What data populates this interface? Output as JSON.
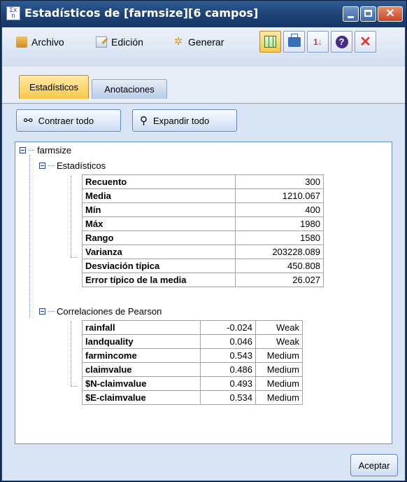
{
  "window": {
    "title": "Estadísticos de [farmsize][6 campos]",
    "icon_text": "ΣX n"
  },
  "menu": {
    "file": "Archivo",
    "edit": "Edición",
    "generate": "Generar"
  },
  "toolbar_icons": [
    "table-icon",
    "print-icon",
    "sort-icon",
    "help-icon",
    "close-x-icon"
  ],
  "tabs": {
    "statistics": "Estadísticos",
    "annotations": "Anotaciones"
  },
  "actions": {
    "collapse_all": "Contraer todo",
    "expand_all": "Expandir todo"
  },
  "tree": {
    "root": "farmsize",
    "statistics_node": "Estadísticos",
    "correlations_node": "Correlaciones de Pearson",
    "statistics": [
      {
        "label": "Recuento",
        "value": "300"
      },
      {
        "label": "Media",
        "value": "1210.067"
      },
      {
        "label": "Mín",
        "value": "400"
      },
      {
        "label": "Máx",
        "value": "1980"
      },
      {
        "label": "Rango",
        "value": "1580"
      },
      {
        "label": "Varianza",
        "value": "203228.089"
      },
      {
        "label": "Desviación típica",
        "value": "450.808"
      },
      {
        "label": "Error típico de la media",
        "value": "26.027"
      }
    ],
    "correlations": [
      {
        "field": "rainfall",
        "value": "-0.024",
        "strength": "Weak"
      },
      {
        "field": "landquality",
        "value": "0.046",
        "strength": "Weak"
      },
      {
        "field": "farmincome",
        "value": "0.543",
        "strength": "Medium"
      },
      {
        "field": "claimvalue",
        "value": "0.486",
        "strength": "Medium"
      },
      {
        "field": "$N-claimvalue",
        "value": "0.493",
        "strength": "Medium"
      },
      {
        "field": "$E-claimvalue",
        "value": "0.534",
        "strength": "Medium"
      }
    ]
  },
  "footer": {
    "ok": "Aceptar"
  },
  "colors": {
    "title_bar": "#1c3f72",
    "active_tab": "#f7c948",
    "content_bg": "#d9e4f4"
  }
}
